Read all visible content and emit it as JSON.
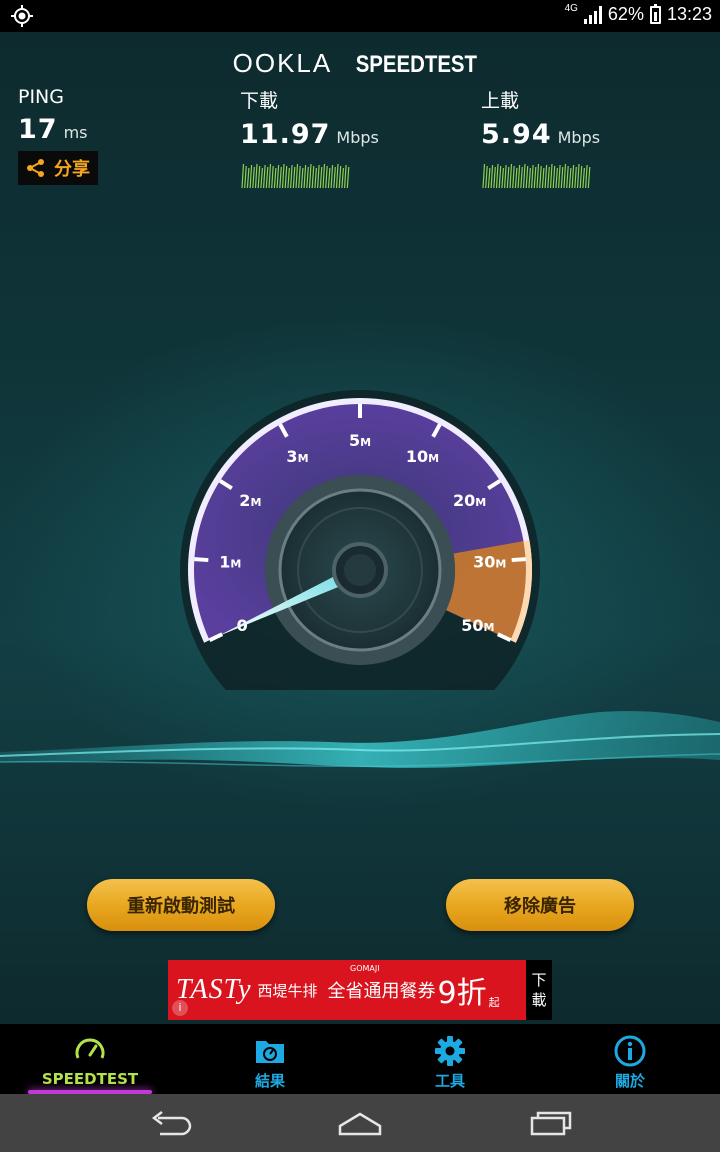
{
  "status_bar": {
    "network": "4G",
    "battery": "62%",
    "time": "13:23"
  },
  "header": {
    "brand": "OOKLA",
    "product": "SPEEDTEST"
  },
  "stats": {
    "ping": {
      "label": "PING",
      "value": "17",
      "unit": "ms"
    },
    "download": {
      "label": "下載",
      "value": "11.97",
      "unit": "Mbps"
    },
    "upload": {
      "label": "上載",
      "value": "5.94",
      "unit": "Mbps"
    },
    "share_label": "分享"
  },
  "gauge": {
    "ticks": [
      {
        "num": "0",
        "suffix": ""
      },
      {
        "num": "1",
        "suffix": "M"
      },
      {
        "num": "2",
        "suffix": "M"
      },
      {
        "num": "3",
        "suffix": "M"
      },
      {
        "num": "5",
        "suffix": "M"
      },
      {
        "num": "10",
        "suffix": "M"
      },
      {
        "num": "20",
        "suffix": "M"
      },
      {
        "num": "30",
        "suffix": "M"
      },
      {
        "num": "50",
        "suffix": "M"
      }
    ]
  },
  "buttons": {
    "restart": "重新啟動測試",
    "remove_ads": "移除廣告"
  },
  "ad": {
    "brand": "TASTy",
    "brand_sub": "西堤牛排",
    "badge": "GOMAJI",
    "promo": "全省通用餐券",
    "promo_big": "9折",
    "promo_small": "起",
    "download_top": "下",
    "download_bottom": "載",
    "info": "i"
  },
  "tabs": [
    {
      "label": "SPEEDTEST",
      "icon": "speedometer-icon",
      "active": true
    },
    {
      "label": "結果",
      "icon": "results-folder-icon",
      "active": false
    },
    {
      "label": "工具",
      "icon": "gear-icon",
      "active": false
    },
    {
      "label": "關於",
      "icon": "info-icon",
      "active": false
    }
  ],
  "colors": {
    "accent_gold": "#f5a623",
    "tab_active": "#b3e24a",
    "tab_inactive": "#1da9e1",
    "gauge_purple": "#5b3f9c",
    "gauge_orange": "#c97a2a"
  }
}
